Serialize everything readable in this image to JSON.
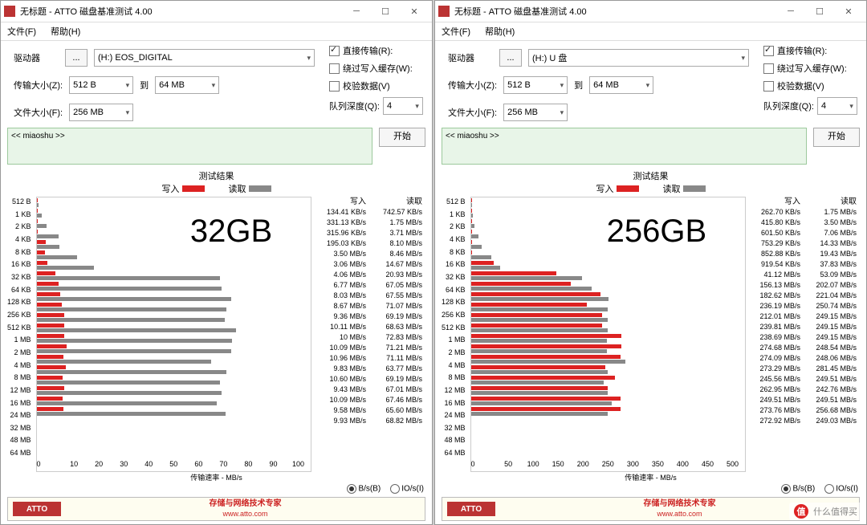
{
  "title": "无标题 - ATTO 磁盘基准测试 4.00",
  "menu": {
    "file": "文件(F)",
    "help": "帮助(H)"
  },
  "labels": {
    "drive": "驱动器",
    "xferSize": "传输大小(Z):",
    "to": "到",
    "fileSize": "文件大小(F):",
    "direct": "直接传输(R):",
    "bypass": "绕过写入缓存(W):",
    "verify": "校验数据(V)",
    "queue": "队列深度(Q):",
    "start": "开始",
    "desc": "<< miaoshu >>",
    "resultTitle": "测试结果",
    "writeLegend": "写入",
    "readLegend": "读取",
    "writeHdr": "写入",
    "readHdr": "读取",
    "axisLabel": "传输速率 - MB/s",
    "bsRadio": "B/s(B)",
    "ioRadio": "IO/s(I)",
    "slogan": "存储与网络技术专家",
    "url": "www.atto.com",
    "attoLogo": "ATTO",
    "wmText": "什么值得买",
    "wmIcon": "值"
  },
  "common": {
    "xfrom": "512 B",
    "xto": "64 MB",
    "fsize": "256 MB",
    "qdepth": "4"
  },
  "windows": [
    {
      "drive": "(H:) EOS_DIGITAL",
      "overlay": "32GB",
      "xmax": 100,
      "xticks": [
        0,
        10,
        20,
        30,
        40,
        50,
        60,
        70,
        80,
        90,
        100
      ],
      "rows": [
        {
          "lbl": "512 B",
          "wv": "134.41 KB/s",
          "rv": "742.57 KB/s",
          "w": 0.13,
          "r": 0.74
        },
        {
          "lbl": "1 KB",
          "wv": "331.13 KB/s",
          "rv": "1.75 MB/s",
          "w": 0.33,
          "r": 1.75
        },
        {
          "lbl": "2 KB",
          "wv": "315.96 KB/s",
          "rv": "3.71 MB/s",
          "w": 0.32,
          "r": 3.71
        },
        {
          "lbl": "4 KB",
          "wv": "195.03 KB/s",
          "rv": "8.10 MB/s",
          "w": 0.2,
          "r": 8.1
        },
        {
          "lbl": "8 KB",
          "wv": "3.50 MB/s",
          "rv": "8.46 MB/s",
          "w": 3.5,
          "r": 8.46
        },
        {
          "lbl": "16 KB",
          "wv": "3.06 MB/s",
          "rv": "14.67 MB/s",
          "w": 3.06,
          "r": 14.67
        },
        {
          "lbl": "32 KB",
          "wv": "4.06 MB/s",
          "rv": "20.93 MB/s",
          "w": 4.06,
          "r": 20.93
        },
        {
          "lbl": "64 KB",
          "wv": "6.77 MB/s",
          "rv": "67.05 MB/s",
          "w": 6.77,
          "r": 67.05
        },
        {
          "lbl": "128 KB",
          "wv": "8.03 MB/s",
          "rv": "67.55 MB/s",
          "w": 8.03,
          "r": 67.55
        },
        {
          "lbl": "256 KB",
          "wv": "8.67 MB/s",
          "rv": "71.07 MB/s",
          "w": 8.67,
          "r": 71.07
        },
        {
          "lbl": "512 KB",
          "wv": "9.36 MB/s",
          "rv": "69.19 MB/s",
          "w": 9.36,
          "r": 69.19
        },
        {
          "lbl": "1 MB",
          "wv": "10.11 MB/s",
          "rv": "68.63 MB/s",
          "w": 10.11,
          "r": 68.63
        },
        {
          "lbl": "2 MB",
          "wv": "10 MB/s",
          "rv": "72.83 MB/s",
          "w": 10,
          "r": 72.83
        },
        {
          "lbl": "4 MB",
          "wv": "10.09 MB/s",
          "rv": "71.21 MB/s",
          "w": 10.09,
          "r": 71.21
        },
        {
          "lbl": "8 MB",
          "wv": "10.96 MB/s",
          "rv": "71.11 MB/s",
          "w": 10.96,
          "r": 71.11
        },
        {
          "lbl": "12 MB",
          "wv": "9.83 MB/s",
          "rv": "63.77 MB/s",
          "w": 9.83,
          "r": 63.77
        },
        {
          "lbl": "16 MB",
          "wv": "10.60 MB/s",
          "rv": "69.19 MB/s",
          "w": 10.6,
          "r": 69.19
        },
        {
          "lbl": "24 MB",
          "wv": "9.43 MB/s",
          "rv": "67.01 MB/s",
          "w": 9.43,
          "r": 67.01
        },
        {
          "lbl": "32 MB",
          "wv": "10.09 MB/s",
          "rv": "67.46 MB/s",
          "w": 10.09,
          "r": 67.46
        },
        {
          "lbl": "48 MB",
          "wv": "9.58 MB/s",
          "rv": "65.60 MB/s",
          "w": 9.58,
          "r": 65.6
        },
        {
          "lbl": "64 MB",
          "wv": "9.93 MB/s",
          "rv": "68.82 MB/s",
          "w": 9.93,
          "r": 68.82
        }
      ]
    },
    {
      "drive": "(H:) U 盘",
      "overlay": "256GB",
      "xmax": 500,
      "xticks": [
        0,
        50,
        100,
        150,
        200,
        250,
        300,
        350,
        400,
        450,
        500
      ],
      "rows": [
        {
          "lbl": "512 B",
          "wv": "262.70 KB/s",
          "rv": "1.75 MB/s",
          "w": 0.26,
          "r": 1.75
        },
        {
          "lbl": "1 KB",
          "wv": "415.80 KB/s",
          "rv": "3.50 MB/s",
          "w": 0.42,
          "r": 3.5
        },
        {
          "lbl": "2 KB",
          "wv": "601.50 KB/s",
          "rv": "7.06 MB/s",
          "w": 0.6,
          "r": 7.06
        },
        {
          "lbl": "4 KB",
          "wv": "753.29 KB/s",
          "rv": "14.33 MB/s",
          "w": 0.75,
          "r": 14.33
        },
        {
          "lbl": "8 KB",
          "wv": "852.88 KB/s",
          "rv": "19.43 MB/s",
          "w": 0.85,
          "r": 19.43
        },
        {
          "lbl": "16 KB",
          "wv": "919.54 KB/s",
          "rv": "37.83 MB/s",
          "w": 0.92,
          "r": 37.83
        },
        {
          "lbl": "32 KB",
          "wv": "41.12 MB/s",
          "rv": "53.09 MB/s",
          "w": 41.12,
          "r": 53.09
        },
        {
          "lbl": "64 KB",
          "wv": "156.13 MB/s",
          "rv": "202.07 MB/s",
          "w": 156.13,
          "r": 202.07
        },
        {
          "lbl": "128 KB",
          "wv": "182.62 MB/s",
          "rv": "221.04 MB/s",
          "w": 182.62,
          "r": 221.04
        },
        {
          "lbl": "256 KB",
          "wv": "236.19 MB/s",
          "rv": "250.74 MB/s",
          "w": 236.19,
          "r": 250.74
        },
        {
          "lbl": "512 KB",
          "wv": "212.01 MB/s",
          "rv": "249.15 MB/s",
          "w": 212.01,
          "r": 249.15
        },
        {
          "lbl": "1 MB",
          "wv": "239.81 MB/s",
          "rv": "249.15 MB/s",
          "w": 239.81,
          "r": 249.15
        },
        {
          "lbl": "2 MB",
          "wv": "238.69 MB/s",
          "rv": "249.15 MB/s",
          "w": 238.69,
          "r": 249.15
        },
        {
          "lbl": "4 MB",
          "wv": "274.68 MB/s",
          "rv": "248.54 MB/s",
          "w": 274.68,
          "r": 248.54
        },
        {
          "lbl": "8 MB",
          "wv": "274.09 MB/s",
          "rv": "248.06 MB/s",
          "w": 274.09,
          "r": 248.06
        },
        {
          "lbl": "12 MB",
          "wv": "273.29 MB/s",
          "rv": "281.45 MB/s",
          "w": 273.29,
          "r": 281.45
        },
        {
          "lbl": "16 MB",
          "wv": "245.56 MB/s",
          "rv": "249.51 MB/s",
          "w": 245.56,
          "r": 249.51
        },
        {
          "lbl": "24 MB",
          "wv": "262.95 MB/s",
          "rv": "242.76 MB/s",
          "w": 262.95,
          "r": 242.76
        },
        {
          "lbl": "32 MB",
          "wv": "249.51 MB/s",
          "rv": "249.51 MB/s",
          "w": 249.51,
          "r": 249.51
        },
        {
          "lbl": "48 MB",
          "wv": "273.76 MB/s",
          "rv": "256.68 MB/s",
          "w": 273.76,
          "r": 256.68
        },
        {
          "lbl": "64 MB",
          "wv": "272.92 MB/s",
          "rv": "249.03 MB/s",
          "w": 272.92,
          "r": 249.03
        }
      ]
    }
  ],
  "chart_data": [
    {
      "type": "bar",
      "title": "测试结果 (32GB)",
      "xlabel": "传输速率 - MB/s",
      "ylabel": "",
      "xlim": [
        0,
        100
      ],
      "categories": [
        "512 B",
        "1 KB",
        "2 KB",
        "4 KB",
        "8 KB",
        "16 KB",
        "32 KB",
        "64 KB",
        "128 KB",
        "256 KB",
        "512 KB",
        "1 MB",
        "2 MB",
        "4 MB",
        "8 MB",
        "12 MB",
        "16 MB",
        "24 MB",
        "32 MB",
        "48 MB",
        "64 MB"
      ],
      "series": [
        {
          "name": "写入",
          "values": [
            0.13,
            0.33,
            0.32,
            0.2,
            3.5,
            3.06,
            4.06,
            6.77,
            8.03,
            8.67,
            9.36,
            10.11,
            10.0,
            10.09,
            10.96,
            9.83,
            10.6,
            9.43,
            10.09,
            9.58,
            9.93
          ]
        },
        {
          "name": "读取",
          "values": [
            0.74,
            1.75,
            3.71,
            8.1,
            8.46,
            14.67,
            20.93,
            67.05,
            67.55,
            71.07,
            69.19,
            68.63,
            72.83,
            71.21,
            71.11,
            63.77,
            69.19,
            67.01,
            67.46,
            65.6,
            68.82
          ]
        }
      ]
    },
    {
      "type": "bar",
      "title": "测试结果 (256GB)",
      "xlabel": "传输速率 - MB/s",
      "ylabel": "",
      "xlim": [
        0,
        500
      ],
      "categories": [
        "512 B",
        "1 KB",
        "2 KB",
        "4 KB",
        "8 KB",
        "16 KB",
        "32 KB",
        "64 KB",
        "128 KB",
        "256 KB",
        "512 KB",
        "1 MB",
        "2 MB",
        "4 MB",
        "8 MB",
        "12 MB",
        "16 MB",
        "24 MB",
        "32 MB",
        "48 MB",
        "64 MB"
      ],
      "series": [
        {
          "name": "写入",
          "values": [
            0.26,
            0.42,
            0.6,
            0.75,
            0.85,
            0.92,
            41.12,
            156.13,
            182.62,
            236.19,
            212.01,
            239.81,
            238.69,
            274.68,
            274.09,
            273.29,
            245.56,
            262.95,
            249.51,
            273.76,
            272.92
          ]
        },
        {
          "name": "读取",
          "values": [
            1.75,
            3.5,
            7.06,
            14.33,
            19.43,
            37.83,
            53.09,
            202.07,
            221.04,
            250.74,
            249.15,
            249.15,
            249.15,
            248.54,
            248.06,
            281.45,
            249.51,
            242.76,
            249.51,
            256.68,
            249.03
          ]
        }
      ]
    }
  ]
}
